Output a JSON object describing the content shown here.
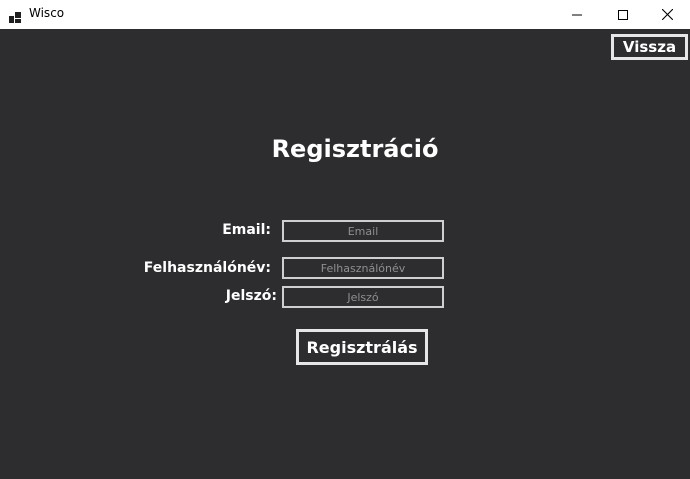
{
  "window": {
    "title": "Wisco",
    "icon": "app-window-icon",
    "controls": [
      "minimize-icon",
      "maximize-icon",
      "close-icon"
    ]
  },
  "form": {
    "back_label": "Vissza",
    "heading": "Regisztráció",
    "email_label": "Email:",
    "email_placeholder": "Email",
    "username_label": "Felhasználónév:",
    "username_placeholder": "Felhasználónév",
    "password_label": "Jelszó:",
    "password_placeholder": "Jelszó",
    "submit_label": "Regisztrálás"
  },
  "colors": {
    "background": "#2d2d30",
    "titlebar": "#ffffff",
    "text": "#ffffff",
    "border": "#e6e6e6"
  }
}
